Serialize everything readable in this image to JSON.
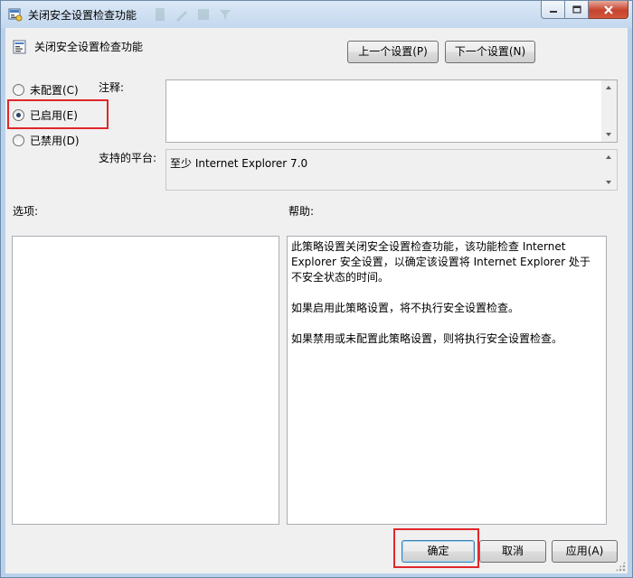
{
  "window": {
    "title": "关闭安全设置检查功能"
  },
  "header": {
    "policy_name": "关闭安全设置检查功能",
    "prev_button": "上一个设置(P)",
    "next_button": "下一个设置(N)"
  },
  "state": {
    "options": [
      {
        "label": "未配置(C)",
        "checked": false
      },
      {
        "label": "已启用(E)",
        "checked": true
      },
      {
        "label": "已禁用(D)",
        "checked": false
      }
    ]
  },
  "comment": {
    "label": "注释:",
    "value": ""
  },
  "platform": {
    "label": "支持的平台:",
    "value": "至少 Internet Explorer 7.0"
  },
  "options_panel": {
    "label": "选项:"
  },
  "help_panel": {
    "label": "帮助:",
    "paragraphs": [
      "此策略设置关闭安全设置检查功能，该功能检查 Internet Explorer 安全设置，以确定该设置将 Internet Explorer 处于不安全状态的时间。",
      "如果启用此策略设置，将不执行安全设置检查。",
      "如果禁用或未配置此策略设置，则将执行安全设置检查。"
    ]
  },
  "footer": {
    "ok": "确定",
    "cancel": "取消",
    "apply": "应用(A)"
  },
  "colors": {
    "highlight_border": "#e0272b",
    "window_frame": "#b9d1ea",
    "dialog_bg": "#f0f0f0"
  }
}
